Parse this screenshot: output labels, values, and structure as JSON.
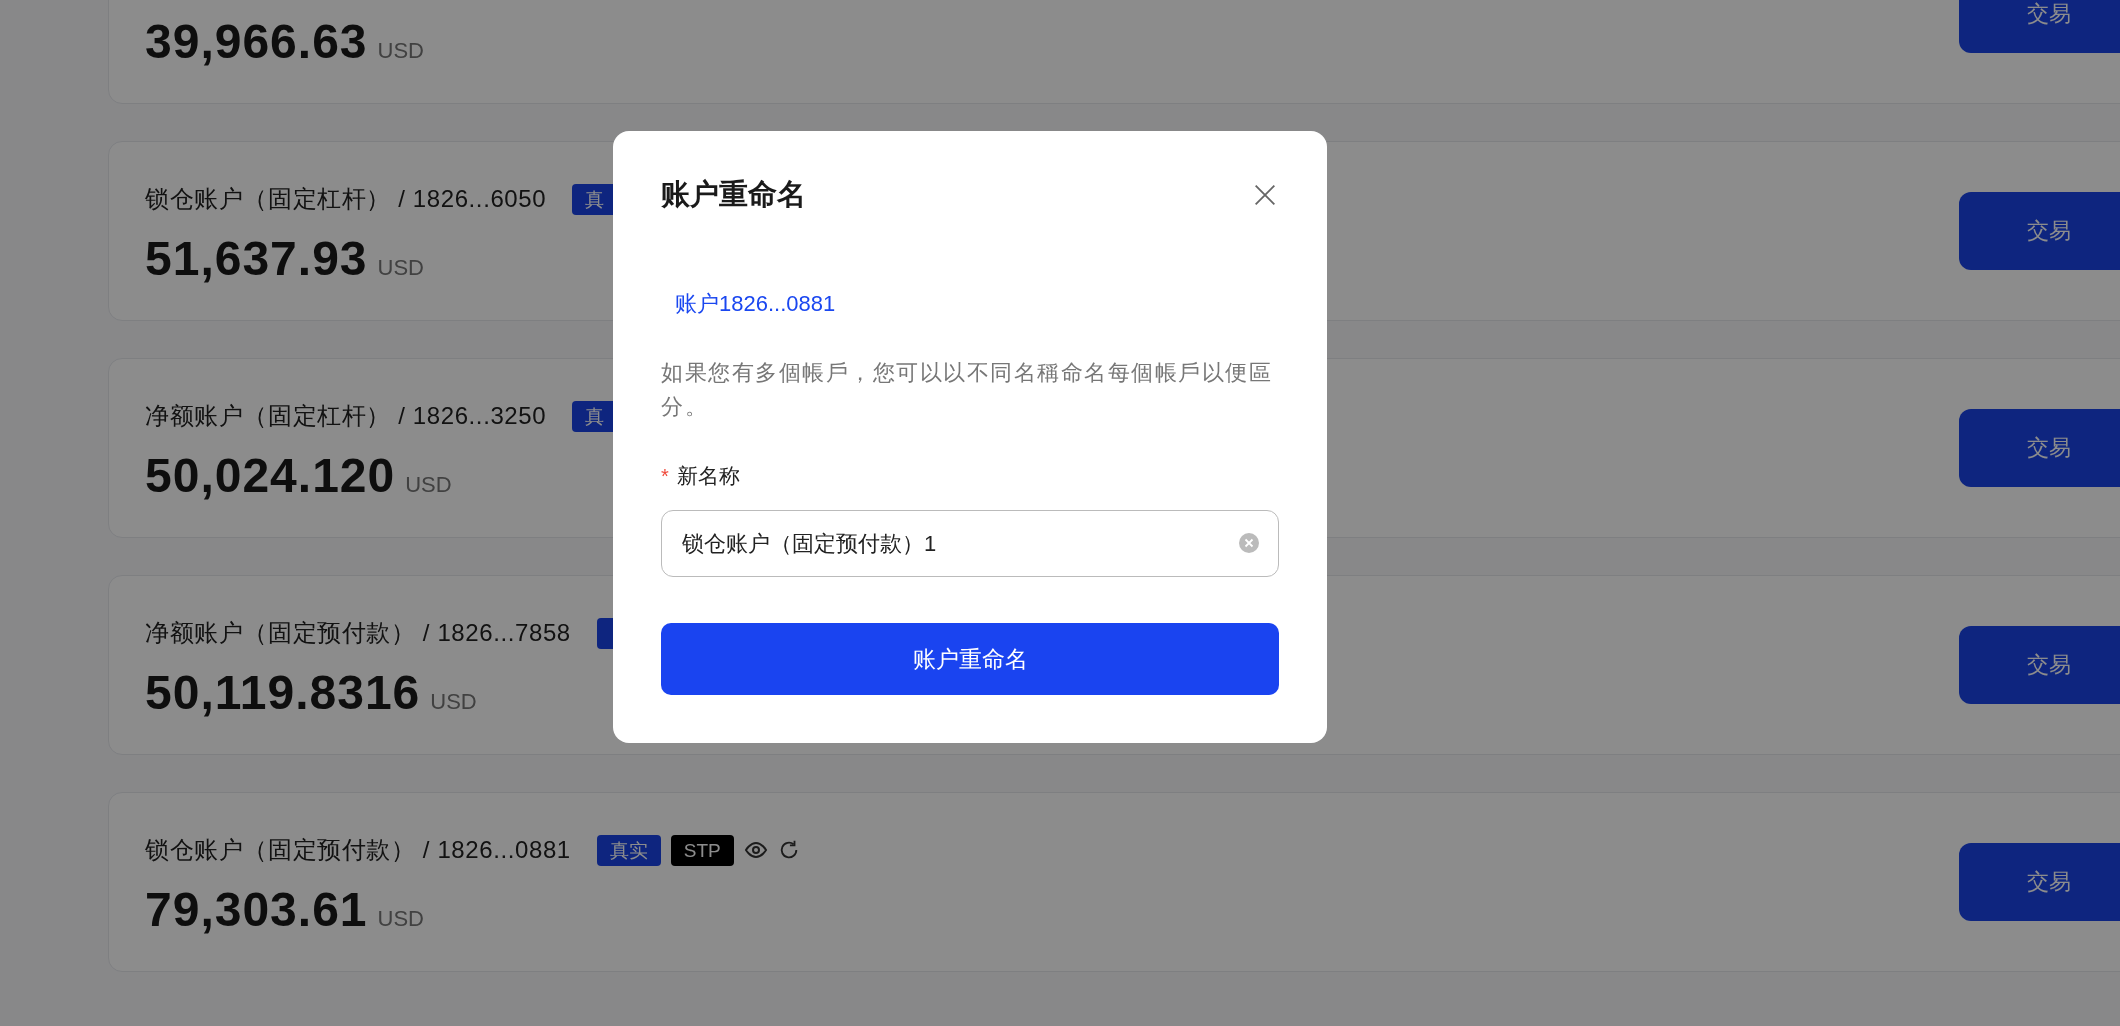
{
  "cards": [
    {
      "amount": "39,966.63",
      "currency": "USD",
      "action": "交易"
    },
    {
      "title": "锁仓账户（固定杠杆） / 1826...6050",
      "tags": [
        {
          "label": "真",
          "kind": "real"
        }
      ],
      "tools": false,
      "amount": "51,637.93",
      "currency": "USD",
      "action": "交易"
    },
    {
      "title": "净额账户（固定杠杆） / 1826...3250",
      "tags": [
        {
          "label": "真",
          "kind": "real"
        }
      ],
      "tools": false,
      "amount": "50,024.120",
      "currency": "USD",
      "action": "交易"
    },
    {
      "title": "净额账户（固定预付款） / 1826...7858",
      "tags": [
        {
          "kind": "real"
        }
      ],
      "tools": false,
      "amount": "50,119.8316",
      "currency": "USD",
      "action": "交易"
    },
    {
      "title": "锁仓账户（固定预付款） / 1826...0881",
      "tags": [
        {
          "label": "真实",
          "kind": "real"
        },
        {
          "label": "STP",
          "kind": "stp"
        }
      ],
      "tools": true,
      "amount": "79,303.61",
      "currency": "USD",
      "action": "交易"
    }
  ],
  "dialog": {
    "title": "账户重命名",
    "account": "账户1826...0881",
    "description": "如果您有多個帳戶，您可以以不同名稱命名每個帳戶以便區分。",
    "field": {
      "label": "新名称",
      "required": true,
      "required_mark": "*",
      "value": "锁仓账户（固定预付款）1"
    },
    "submit": "账户重命名"
  }
}
